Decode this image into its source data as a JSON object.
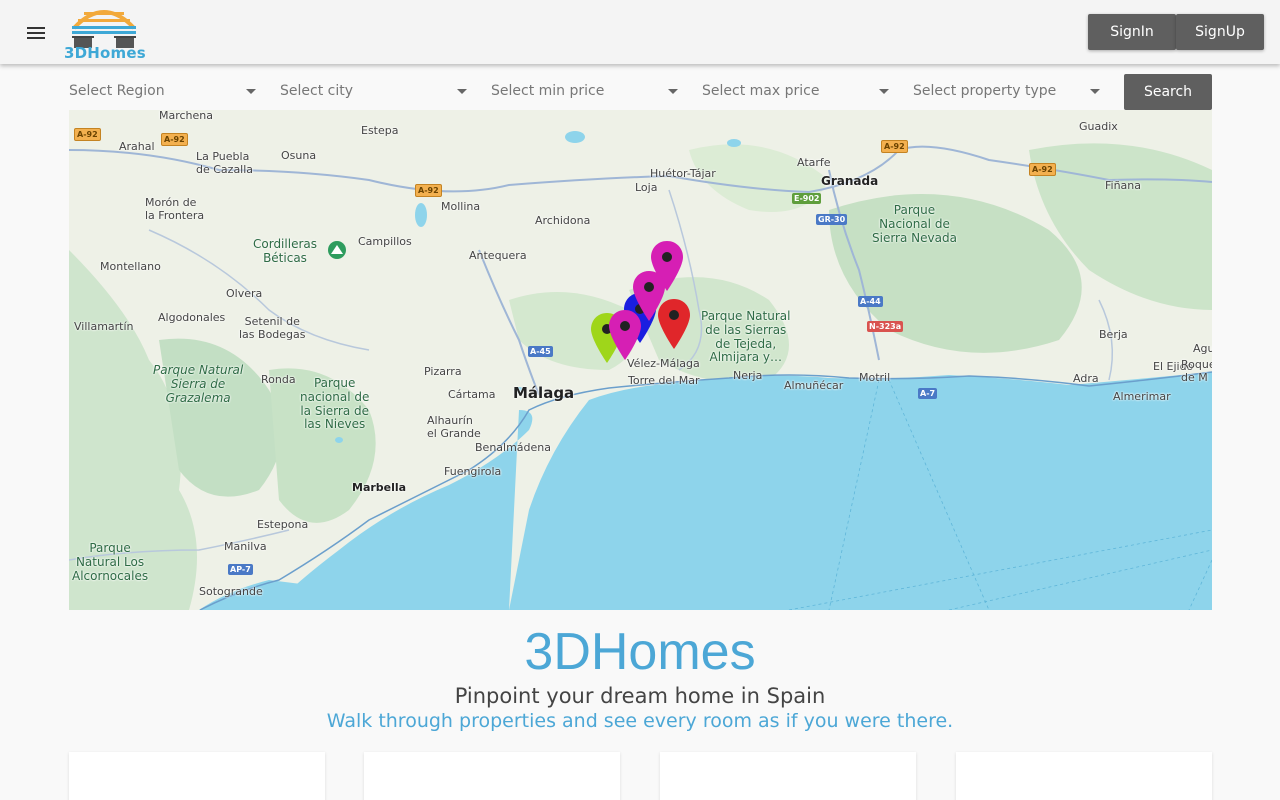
{
  "header": {
    "logo_text": "3DHomes",
    "signin_label": "SignIn",
    "signup_label": "SignUp"
  },
  "filters": {
    "region": "Select Region",
    "city": "Select city",
    "min_price": "Select min price",
    "max_price": "Select max price",
    "property_type": "Select property type",
    "search_label": "Search"
  },
  "map": {
    "places": {
      "marchena": "Marchena",
      "arahal": "Arahal",
      "estepa": "Estepa",
      "la_puebla": "La Puebla\nde Cazalla",
      "osuna": "Osuna",
      "moron": "Morón de\nla Frontera",
      "cordilleras": "Cordilleras\nBéticas",
      "campillos": "Campillos",
      "mollina": "Mollina",
      "antequera": "Antequera",
      "archidona": "Archidona",
      "huetor": "Huétor-Tájar",
      "loja": "Loja",
      "atarfe": "Atarfe",
      "granada": "Granada",
      "guadix": "Guadix",
      "finana": "Fiñana",
      "sierra_nevada": "Parque\nNacional de\nSierra Nevada",
      "montellano": "Montellano",
      "olvera": "Olvera",
      "villamartin": "Villamartín",
      "algodonales": "Algodonales",
      "setenil": "Setenil de\nlas Bodegas",
      "grazalema": "Parque Natural\nSierra de\nGrazalema",
      "ronda": "Ronda",
      "nieves": "Parque\nnacional de\nla Sierra de\nlas Nieves",
      "pizarra": "Pizarra",
      "cartama": "Cártama",
      "malaga": "Málaga",
      "alhaurin": "Alhaurín\nel Grande",
      "benalmadena": "Benalmádena",
      "fuengirola": "Fuengirola",
      "marbella": "Marbella",
      "estepona": "Estepona",
      "manilva": "Manilva",
      "sotogrande": "Sotogrande",
      "alcornocales": "Parque\nNatural Los\nAlcornocales",
      "velez": "Vélez-Málaga",
      "torre": "Torre del Mar",
      "nerja": "Nerja",
      "almunecar": "Almuñécar",
      "motril": "Motril",
      "tejeda": "Parque Natural\nde las Sierras\nde Tejeda,\nAlmijara y…",
      "adra": "Adra",
      "berja": "Berja",
      "ejido": "El Ejido",
      "almerimar": "Almerimar",
      "agu": "Agu",
      "roque": "Roque\nde M"
    },
    "roads": {
      "a92a": "A-92",
      "a92b": "A-92",
      "a92c": "A-92",
      "a92d": "A-92",
      "a92e": "A-92",
      "e902": "E-902",
      "gr30": "GR-30",
      "a44": "A-44",
      "n323a": "N-323a",
      "a45": "A-45",
      "a7": "A-7",
      "ap7": "AP-7"
    },
    "pin_colors": [
      "#d61fb4",
      "#d61fb4",
      "#1a1ee0",
      "#e0262a",
      "#9fd61a",
      "#d61fb4"
    ]
  },
  "hero": {
    "title": "3DHomes",
    "subtitle": "Pinpoint your dream home in Spain",
    "tagline": "Walk through properties and see every room as if you were there."
  }
}
